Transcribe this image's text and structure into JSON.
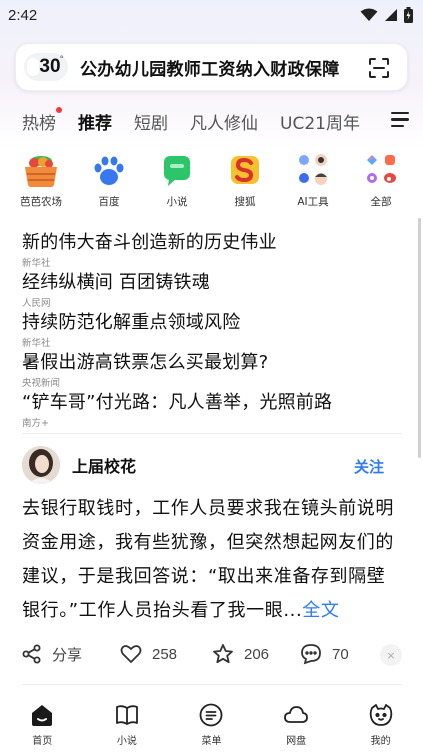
{
  "status_bar": {
    "time": "2:42",
    "icons": [
      "wifi-icon",
      "signal-icon",
      "battery-icon"
    ]
  },
  "search": {
    "temperature": "30",
    "degree": "°",
    "query": "公办幼儿园教师工资纳入财政保障",
    "scan_icon": "scan-icon"
  },
  "tabs": [
    {
      "label": "热榜",
      "has_dot": true
    },
    {
      "label": "推荐",
      "active": true
    },
    {
      "label": "短剧"
    },
    {
      "label": "凡人修仙"
    },
    {
      "label": "UC21周年"
    }
  ],
  "shortcuts": [
    {
      "label": "芭芭农场",
      "icon": "farm-basket-icon"
    },
    {
      "label": "百度",
      "icon": "baidu-paw-icon"
    },
    {
      "label": "小说",
      "icon": "novel-chat-icon"
    },
    {
      "label": "搜狐",
      "icon": "sohu-icon"
    },
    {
      "label": "AI工具",
      "icon": "ai-tools-icon"
    },
    {
      "label": "全部",
      "icon": "all-apps-icon"
    }
  ],
  "news": [
    {
      "title": "新的伟大奋斗创造新的历史伟业",
      "source": "新华社"
    },
    {
      "title": "经纬纵横间 百团铸铁魂",
      "source": "人民网"
    },
    {
      "title": "持续防范化解重点领域风险",
      "source": "新华社"
    },
    {
      "title": "暑假出游高铁票怎么买最划算?",
      "source": "央视新闻"
    },
    {
      "title": "“铲车哥”付光路：凡人善举，光照前路",
      "source": "南方+"
    }
  ],
  "post": {
    "author": "上届校花",
    "follow_label": "关注",
    "body": "去银行取钱时，工作人员要求我在镜头前说明资金用途，我有些犹豫，但突然想起网友们的建议，于是我回答说：“取出来准备存到隔壁银行。”工作人员抬头看了我一眼...",
    "full_text_label": "全文",
    "share_label": "分享",
    "likes": "258",
    "favorites": "206",
    "comments": "70"
  },
  "bottom_nav": [
    {
      "label": "首页",
      "icon": "home-icon"
    },
    {
      "label": "小说",
      "icon": "book-icon"
    },
    {
      "label": "菜单",
      "icon": "menu-icon"
    },
    {
      "label": "网盘",
      "icon": "cloud-icon"
    },
    {
      "label": "我的",
      "icon": "profile-icon"
    }
  ],
  "colors": {
    "accent": "#2e7bf2",
    "tab_dot": "#f13b3b"
  }
}
